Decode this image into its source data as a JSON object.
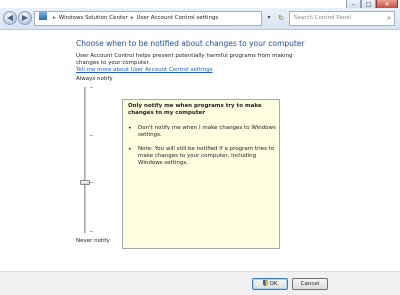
{
  "window": {
    "controls": [
      "–",
      "□",
      "✕"
    ]
  },
  "address_bar": {
    "back_icon": "back-arrow-icon",
    "forward_icon": "forward-arrow-icon",
    "crumb_1": "Windows Solution Center",
    "crumb_2": "User Account Control settings",
    "separator": "▸",
    "dropdown_glyph": "▾",
    "refresh_glyph": "↻",
    "search_placeholder": "Search Control Panel",
    "search_glyph": "⌕"
  },
  "main": {
    "heading": "Choose when to be notified about changes to your computer",
    "description": "User Account Control helps prevent potentially harmful programs from making changes to your computer.",
    "link": "Tell me more about User Account Control settings",
    "slider_top_label": "Always notify",
    "slider_bottom_label": "Never notify",
    "slider_level": 3,
    "slider_levels": 4
  },
  "info_box": {
    "title": "Only notify me when programs try to make changes to my computer",
    "bullets": [
      "Don't notify me when I make changes to Windows settings.",
      "Note: You will still be notified if a program tries to make changes to your computer, including Windows settings."
    ]
  },
  "buttons": {
    "ok": "OK",
    "cancel": "Cancel"
  }
}
